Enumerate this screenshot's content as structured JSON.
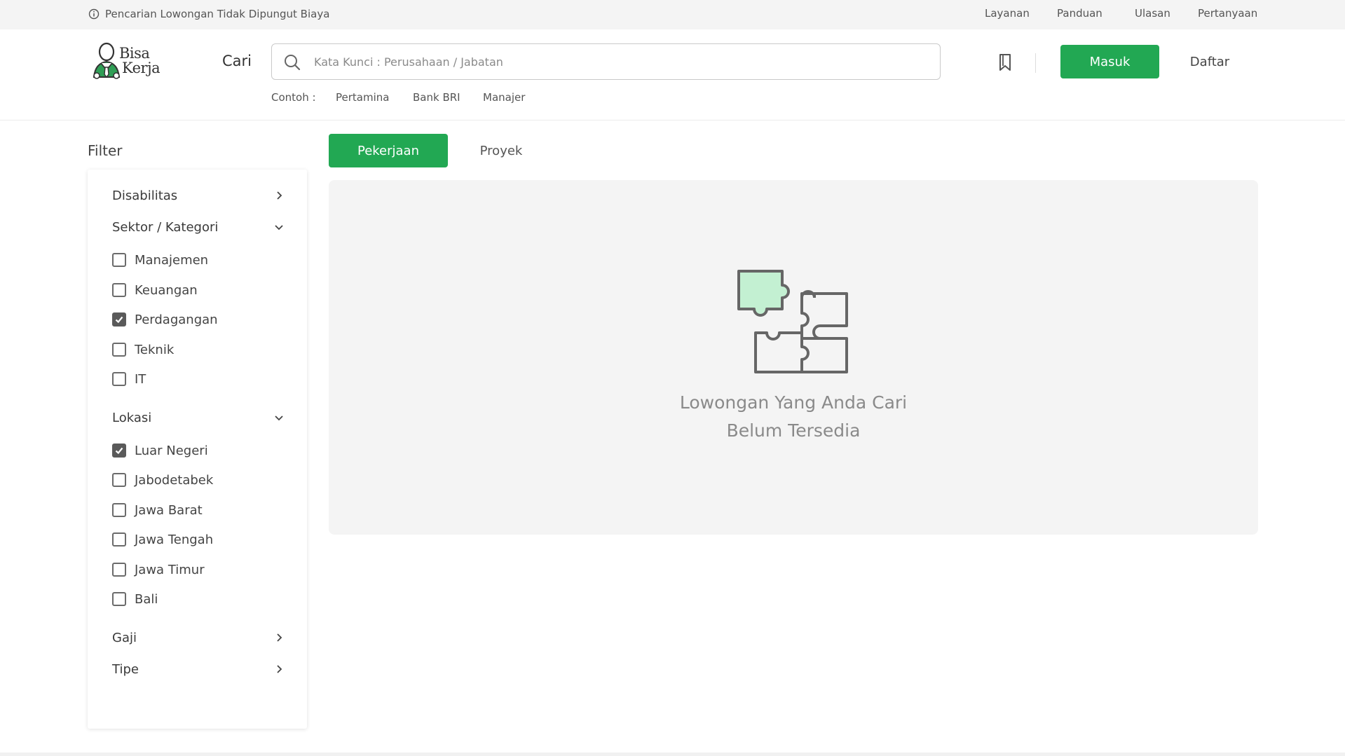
{
  "topbar": {
    "notice": "Pencarian Lowongan Tidak Dipungut Biaya",
    "nav": [
      "Layanan",
      "Panduan",
      "Ulasan",
      "Pertanyaan"
    ]
  },
  "header": {
    "logo_line1": "Bisa",
    "logo_line2": "Kerja",
    "cari_label": "Cari",
    "search_placeholder": "Kata Kunci : Perusahaan / Jabatan",
    "examples_label": "Contoh :",
    "examples": [
      "Pertamina",
      "Bank BRI",
      "Manajer"
    ],
    "login_label": "Masuk",
    "register_label": "Daftar"
  },
  "filter": {
    "title": "Filter",
    "disabilitas": "Disabilitas",
    "sektor": {
      "label": "Sektor / Kategori",
      "options": [
        {
          "label": "Manajemen",
          "checked": false
        },
        {
          "label": "Keuangan",
          "checked": false
        },
        {
          "label": "Perdagangan",
          "checked": true
        },
        {
          "label": "Teknik",
          "checked": false
        },
        {
          "label": "IT",
          "checked": false
        }
      ]
    },
    "lokasi": {
      "label": "Lokasi",
      "options": [
        {
          "label": "Luar Negeri",
          "checked": true
        },
        {
          "label": "Jabodetabek",
          "checked": false
        },
        {
          "label": "Jawa Barat",
          "checked": false
        },
        {
          "label": "Jawa Tengah",
          "checked": false
        },
        {
          "label": "Jawa Timur",
          "checked": false
        },
        {
          "label": "Bali",
          "checked": false
        }
      ]
    },
    "gaji": "Gaji",
    "tipe": "Tipe"
  },
  "tabs": {
    "active": "Pekerjaan",
    "inactive": "Proyek"
  },
  "empty_state": {
    "line1": "Lowongan Yang Anda Cari",
    "line2": "Belum Tersedia",
    "icon": "puzzle-icon"
  },
  "colors": {
    "accent": "#22a853",
    "puzzle_fill": "#c3f0d2"
  }
}
